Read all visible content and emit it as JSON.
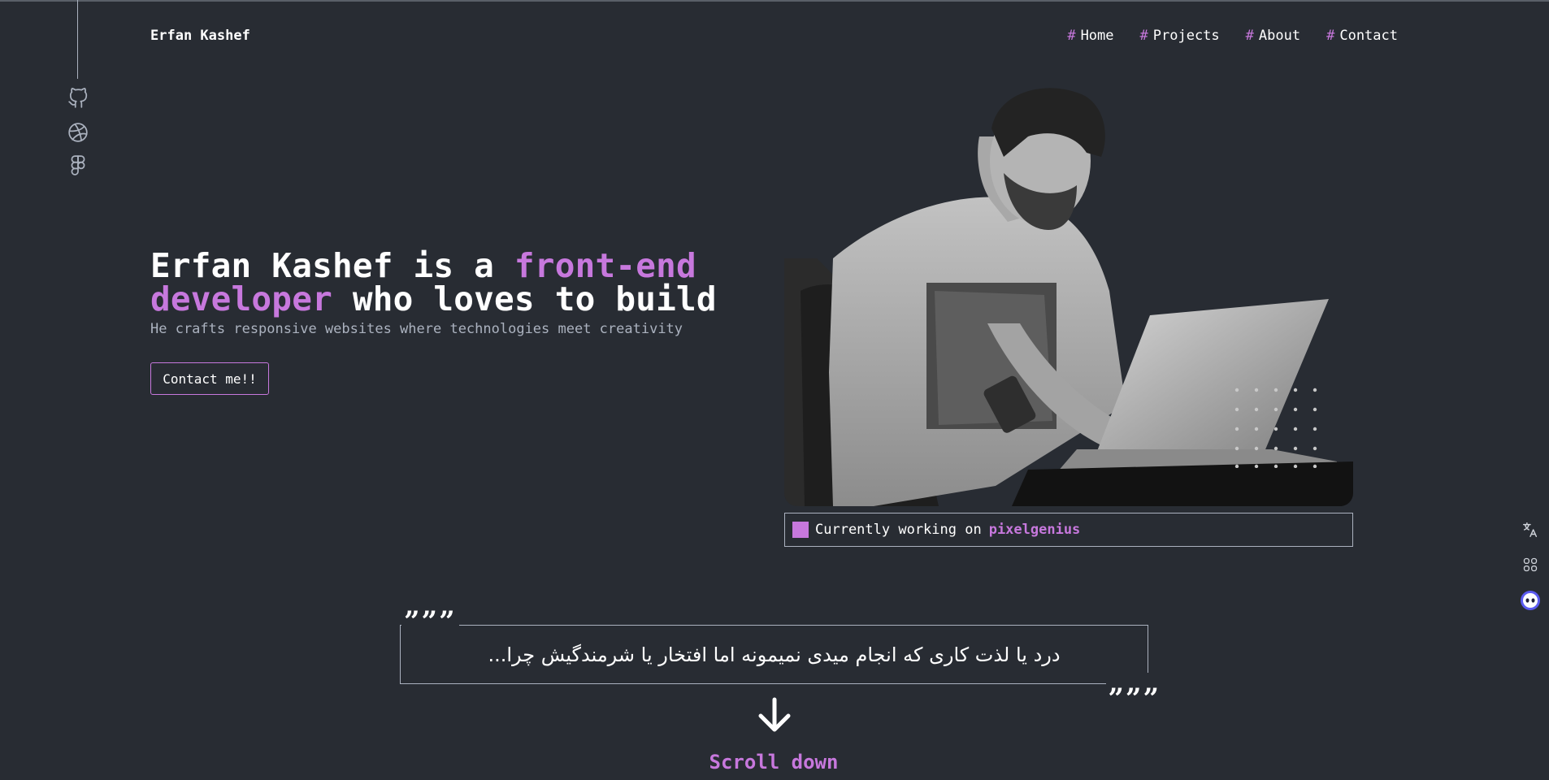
{
  "brand": {
    "name": "Erfan Kashef"
  },
  "nav": {
    "hash": "#",
    "items": [
      {
        "label": "Home"
      },
      {
        "label": "Projects"
      },
      {
        "label": "About"
      },
      {
        "label": "Contact"
      }
    ]
  },
  "social": [
    "github-icon",
    "dribbble-icon",
    "figma-icon"
  ],
  "hero": {
    "headline_part1": "Erfan Kashef is a ",
    "headline_accent": "front-end developer",
    "headline_part2": " who loves to build",
    "subline": "He crafts responsive websites where technologies meet creativity",
    "cta_label": "Contact me!!"
  },
  "status": {
    "label": "Currently working on",
    "project": "pixelgenius"
  },
  "quote": {
    "open_mark": "”””",
    "close_mark": "„„„",
    "text": "درد یا لذت کاری که انجام میدی نمیمونه اما افتخار یا شرمندگیش چرا..."
  },
  "scroll": {
    "label": "Scroll down"
  },
  "side_tools": [
    "translate-icon",
    "apps-icon",
    "assistant-icon"
  ],
  "colors": {
    "background": "#282c33",
    "accent": "#c778dd",
    "text": "#ffffff",
    "muted": "#abb2bf"
  }
}
